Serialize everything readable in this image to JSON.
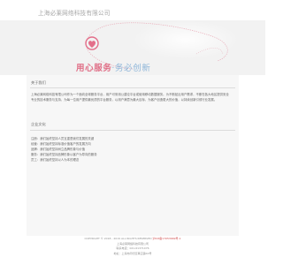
{
  "header": {
    "brand": "上海必莱网络科技有限公司"
  },
  "banner": {
    "logo_left": "用",
    "logo_mid": "心",
    "logo_service": "服务",
    "logo_rest": "·务必创新",
    "colors": {
      "pink": "#e06f87",
      "blue": "#8fb6d9",
      "bg": "#f2f2f2"
    }
  },
  "about": {
    "title": "关于我们",
    "text": "上海必莱网络科技有限公司作为一个面向全球服务平台，用户可采用公建论平台或使用移动数据服务。为不断贴近用户需求，不断在各大地区提供安全专业的技术服务与支持，为每一位用户提供最优质的平台服务，以用户满意为最大目标，为客户创造更大的价值，以持续创新引领行业发展。"
  },
  "culture": {
    "title": "企业文化",
    "items": [
      "注册：我们始终坚持人员互重是我们发展的关键",
      "经营：我们始终坚持标准价值客户的发展方向",
      "品牌：我们始终坚持树立品牌形象与价值",
      "服务：我们始终坚持品牌形象以客户为导向的服务",
      "员工：我们始终坚持以人为本的理念"
    ]
  },
  "footer": {
    "copyright": "COPYRIGHT © 2018 - 2019 ALL RIGHTS RESERVED",
    "icp": "沪ICP备17053669号-1",
    "company": "上海必莱网络科技有限公司",
    "phone": "联系电话：021-61371076",
    "address": "地址：上海市闵行区莘庄镇XX号"
  }
}
